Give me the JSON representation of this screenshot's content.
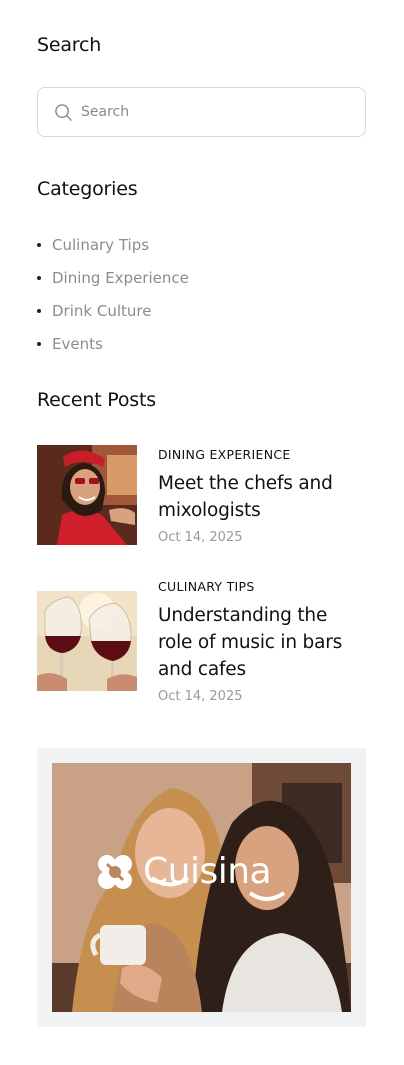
{
  "search": {
    "title": "Search",
    "placeholder": "Search"
  },
  "categories": {
    "title": "Categories",
    "items": [
      {
        "label": "Culinary Tips"
      },
      {
        "label": "Dining Experience"
      },
      {
        "label": "Drink Culture"
      },
      {
        "label": "Events"
      }
    ]
  },
  "recent_posts": {
    "title": "Recent Posts",
    "posts": [
      {
        "category": "DINING EXPERIENCE",
        "title": "Meet the chefs and mixologists",
        "date": "Oct 14, 2025"
      },
      {
        "category": "CULINARY TIPS",
        "title": "Understanding the role of music in bars and cafes",
        "date": "Oct 14, 2025"
      }
    ]
  },
  "promo": {
    "brand_name": "Cuisina"
  },
  "colors": {
    "text": "#111111",
    "muted": "#8c8c8c",
    "border": "#d9d9d9",
    "promo_bg": "#f1f2f4"
  }
}
